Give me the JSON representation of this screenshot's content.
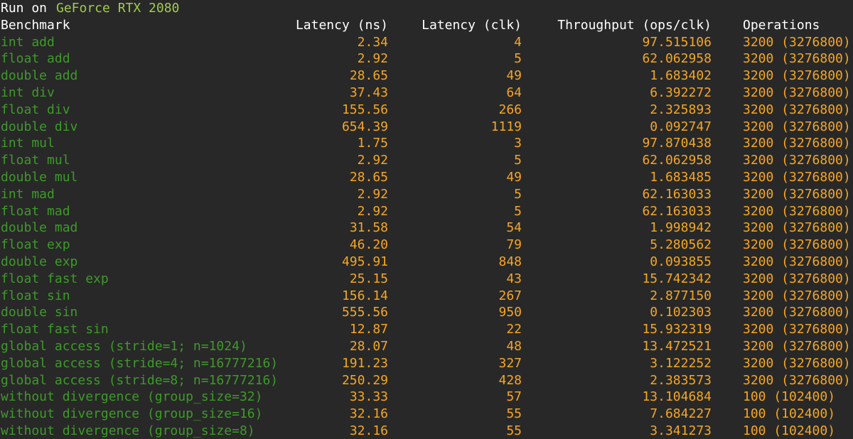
{
  "header": {
    "run_prefix": "Run on",
    "gpu_name": "GeForce RTX 2080"
  },
  "columns": {
    "benchmark": "Benchmark",
    "latency_ns": "Latency (ns)",
    "latency_clk": "Latency (clk)",
    "throughput": "Throughput (ops/clk)",
    "operations": "Operations"
  },
  "colors": {
    "background": "#282828",
    "header_text": "#ffffff",
    "gpu_name": "#9fcd4a",
    "benchmark_name": "#3e9a2a",
    "values": "#f6a623"
  },
  "rows": [
    {
      "name": "int add",
      "ns": "2.34",
      "clk": "4",
      "tp": "97.515106",
      "ops": "3200 (3276800)"
    },
    {
      "name": "float add",
      "ns": "2.92",
      "clk": "5",
      "tp": "62.062958",
      "ops": "3200 (3276800)"
    },
    {
      "name": "double add",
      "ns": "28.65",
      "clk": "49",
      "tp": "1.683402",
      "ops": "3200 (3276800)"
    },
    {
      "name": "int div",
      "ns": "37.43",
      "clk": "64",
      "tp": "6.392272",
      "ops": "3200 (3276800)"
    },
    {
      "name": "float div",
      "ns": "155.56",
      "clk": "266",
      "tp": "2.325893",
      "ops": "3200 (3276800)"
    },
    {
      "name": "double div",
      "ns": "654.39",
      "clk": "1119",
      "tp": "0.092747",
      "ops": "3200 (3276800)"
    },
    {
      "name": "int mul",
      "ns": "1.75",
      "clk": "3",
      "tp": "97.870438",
      "ops": "3200 (3276800)"
    },
    {
      "name": "float mul",
      "ns": "2.92",
      "clk": "5",
      "tp": "62.062958",
      "ops": "3200 (3276800)"
    },
    {
      "name": "double mul",
      "ns": "28.65",
      "clk": "49",
      "tp": "1.683485",
      "ops": "3200 (3276800)"
    },
    {
      "name": "int mad",
      "ns": "2.92",
      "clk": "5",
      "tp": "62.163033",
      "ops": "3200 (3276800)"
    },
    {
      "name": "float mad",
      "ns": "2.92",
      "clk": "5",
      "tp": "62.163033",
      "ops": "3200 (3276800)"
    },
    {
      "name": "double mad",
      "ns": "31.58",
      "clk": "54",
      "tp": "1.998942",
      "ops": "3200 (3276800)"
    },
    {
      "name": "float exp",
      "ns": "46.20",
      "clk": "79",
      "tp": "5.280562",
      "ops": "3200 (3276800)"
    },
    {
      "name": "double exp",
      "ns": "495.91",
      "clk": "848",
      "tp": "0.093855",
      "ops": "3200 (3276800)"
    },
    {
      "name": "float fast exp",
      "ns": "25.15",
      "clk": "43",
      "tp": "15.742342",
      "ops": "3200 (3276800)"
    },
    {
      "name": "float sin",
      "ns": "156.14",
      "clk": "267",
      "tp": "2.877150",
      "ops": "3200 (3276800)"
    },
    {
      "name": "double sin",
      "ns": "555.56",
      "clk": "950",
      "tp": "0.102303",
      "ops": "3200 (3276800)"
    },
    {
      "name": "float fast sin",
      "ns": "12.87",
      "clk": "22",
      "tp": "15.932319",
      "ops": "3200 (3276800)"
    },
    {
      "name": "global access (stride=1; n=1024)",
      "ns": "28.07",
      "clk": "48",
      "tp": "13.472521",
      "ops": "3200 (3276800)"
    },
    {
      "name": "global access (stride=4; n=16777216)",
      "ns": "191.23",
      "clk": "327",
      "tp": "3.122252",
      "ops": "3200 (3276800)"
    },
    {
      "name": "global access (stride=8; n=16777216)",
      "ns": "250.29",
      "clk": "428",
      "tp": "2.383573",
      "ops": "3200 (3276800)"
    },
    {
      "name": "without divergence (group_size=32)",
      "ns": "33.33",
      "clk": "57",
      "tp": "13.104684",
      "ops": "100 (102400)"
    },
    {
      "name": "without divergence (group_size=16)",
      "ns": "32.16",
      "clk": "55",
      "tp": "7.684227",
      "ops": "100 (102400)"
    },
    {
      "name": "without divergence (group_size=8)",
      "ns": "32.16",
      "clk": "55",
      "tp": "3.341273",
      "ops": "100 (102400)"
    }
  ]
}
